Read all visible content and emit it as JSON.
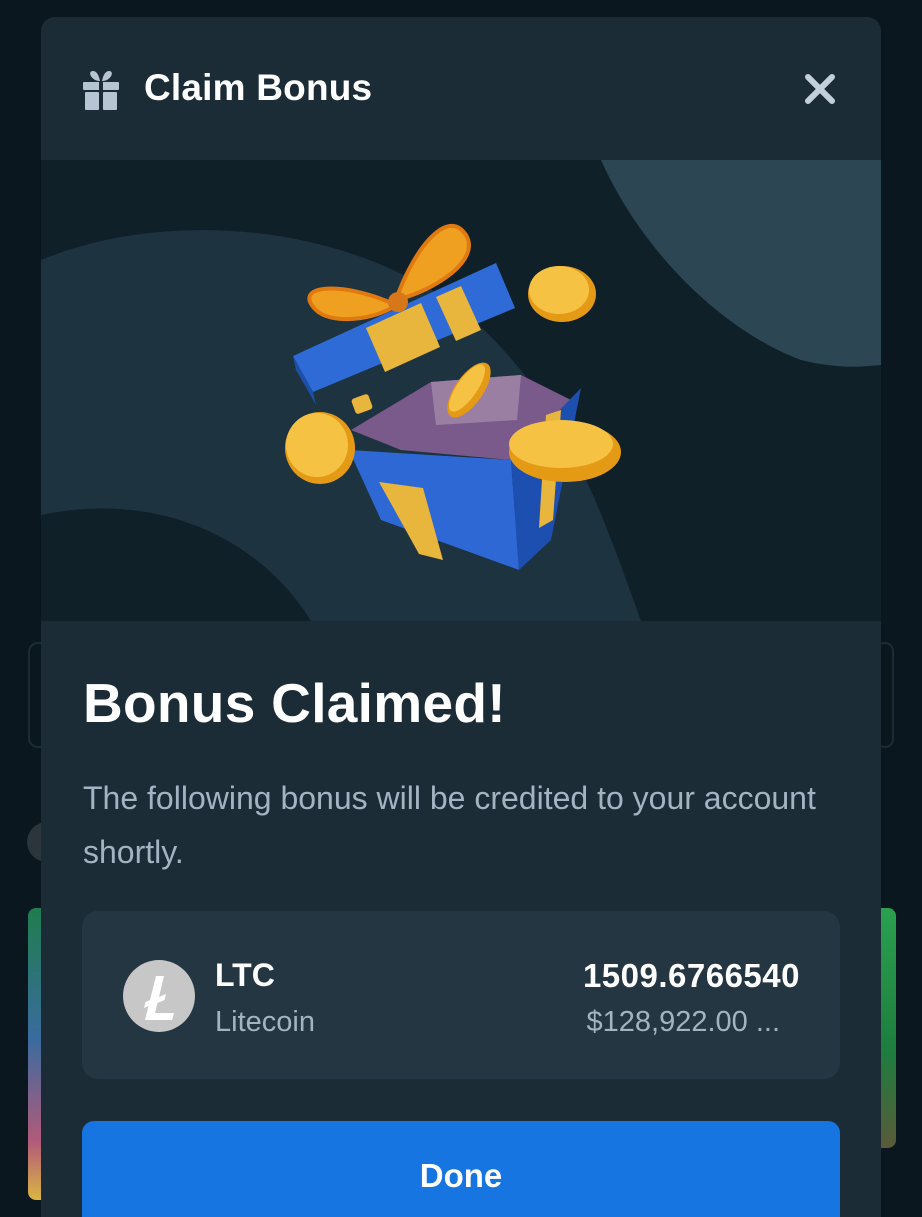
{
  "dialog": {
    "title": "Claim Bonus",
    "close_icon": "close-icon",
    "header_icon": "gift-icon",
    "hero_illustration": "gift-box-with-coins"
  },
  "message": {
    "heading": "Bonus Claimed!",
    "description": "The following bonus will be credited to your account shortly."
  },
  "bonus": {
    "currency_icon": "litecoin-icon",
    "symbol": "LTC",
    "name": "Litecoin",
    "amount": "1509.6766540",
    "usd_value": "$128,922.00 ..."
  },
  "actions": {
    "done_label": "Done"
  },
  "colors": {
    "modal_bg": "#1b2c37",
    "card_bg": "#233642",
    "primary": "#1675e0",
    "muted_text": "#a4b3c1"
  }
}
